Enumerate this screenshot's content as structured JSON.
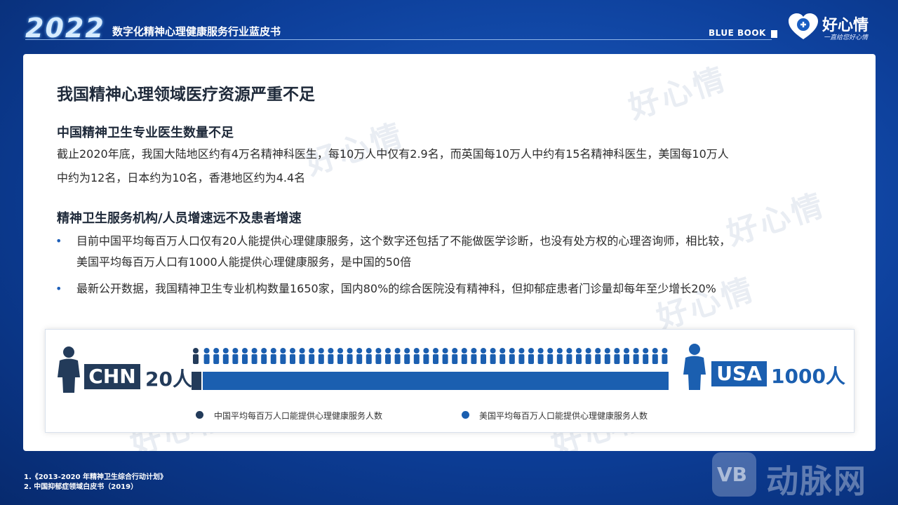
{
  "header": {
    "year": "2022",
    "report_title": "数字化精神心理健康服务行业蓝皮书",
    "blue_book": "BLUE BOOK",
    "logo_text": "好心情",
    "logo_sub": "一直给您好心情"
  },
  "card": {
    "main_title": "我国精神心理领域医疗资源严重不足",
    "section1": {
      "title": "中国精神卫生专业医生数量不足",
      "line1": "截止2020年底，我国大陆地区约有4万名精神科医生，每10万人中仅有2.9名，而英国每10万人中约有15名精神科医生，美国每10万人",
      "line2": "中约为12名，日本约为10名，香港地区约为4.4名"
    },
    "section2": {
      "title": "精神卫生服务机构/人员增速远不及患者增速",
      "bullet_symbol": "•",
      "bullet1_line1": "目前中国平均每百万人口仅有20人能提供心理健康服务，这个数字还包括了不能做医学诊断，也没有处方权的心理咨询师，相比较，",
      "bullet1_line2": "美国平均每百万人口有1000人能提供心理健康服务，是中国的50倍",
      "bullet2": "最新公开数据，我国精神卫生专业机构数量1650家，国内80%的综合医院没有精神科，但抑郁症患者门诊量却每年至少增长20%"
    },
    "watermark_text": "好心情"
  },
  "chart_data": {
    "type": "bar",
    "orientation": "horizontal",
    "categories": [
      "CHN",
      "USA"
    ],
    "values": [
      20,
      1000
    ],
    "value_labels": [
      "20人",
      "1000人"
    ],
    "series": [
      {
        "name": "中国平均每百万人口能提供心理健康服务人数",
        "values": [
          20
        ],
        "color": "#233b5a"
      },
      {
        "name": "美国平均每百万人口能提供心理健康服务人数",
        "values": [
          1000
        ],
        "color": "#1b5fb0"
      }
    ],
    "legend_position": "bottom",
    "icon_count_usa": 50,
    "icon_count_chn": 1
  },
  "footnotes": [
    "1.《2013-2020 年精神卫生综合行动计划》",
    "2. 中国抑郁症领域白皮书（2019）"
  ],
  "watermark_brand": {
    "logo": "VB",
    "name": "动脉网"
  },
  "colors": {
    "chn": "#233b5a",
    "usa": "#1b5fb0",
    "background": "#0d3f9a"
  }
}
